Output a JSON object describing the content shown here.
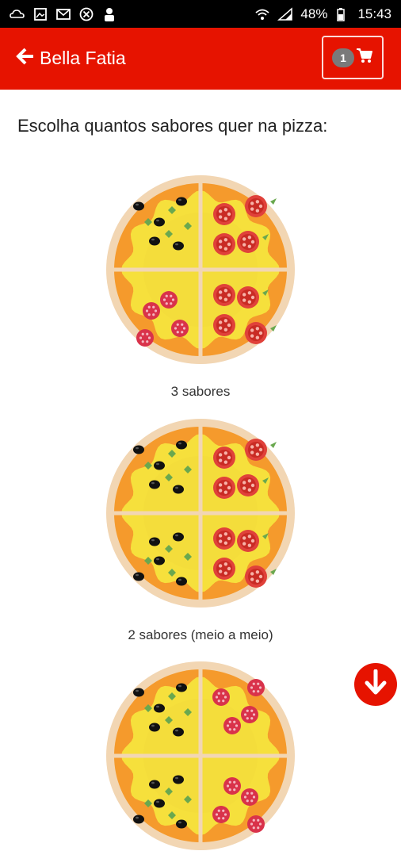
{
  "status_bar": {
    "battery_percent": "48%",
    "time": "15:43",
    "left_icons": [
      "cloud-icon",
      "image-icon",
      "mail-icon",
      "close-circle-icon",
      "user-icon"
    ],
    "right_icons": [
      "wifi-icon",
      "signal-icon",
      "battery-icon"
    ]
  },
  "header": {
    "title": "Bella Fatia",
    "cart_count": "1",
    "icons": {
      "back": "arrow-left-icon",
      "cart": "cart-icon"
    },
    "color": "#e61300"
  },
  "main": {
    "prompt": "Escolha quantos sabores quer na pizza:",
    "options": [
      {
        "label": "3 sabores",
        "toppings": [
          "olive",
          "tomato",
          "pepperoni",
          "tomato"
        ]
      },
      {
        "label": "2 sabores (meio a meio)",
        "toppings": [
          "olive",
          "tomato",
          "olive",
          "tomato"
        ]
      },
      {
        "label": "",
        "toppings": [
          "olive",
          "pepperoni",
          "olive",
          "pepperoni"
        ]
      }
    ]
  },
  "scroll_button": {
    "icon": "arrow-down-icon"
  }
}
